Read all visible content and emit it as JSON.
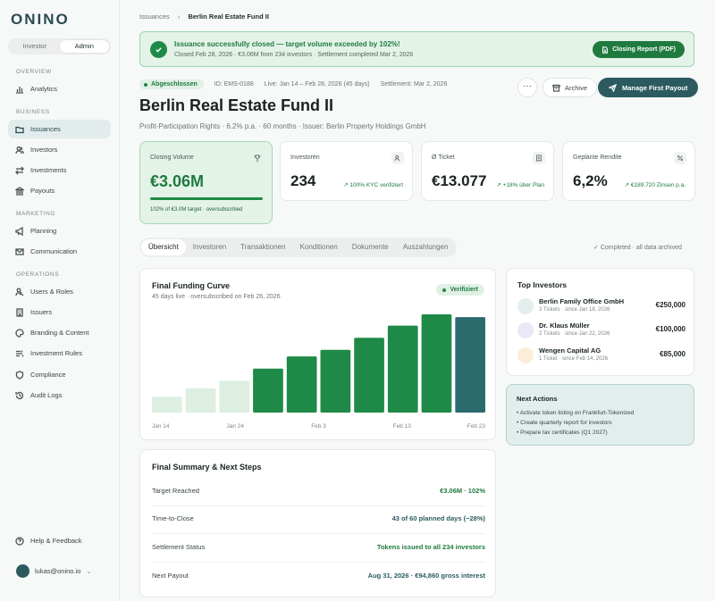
{
  "brand": {
    "logo": "ONINO"
  },
  "role_toggle": {
    "investor": "Investor",
    "admin": "Admin"
  },
  "sidebar": {
    "sections": [
      "OVERVIEW",
      "BUSINESS",
      "MARKETING",
      "OPERATIONS"
    ],
    "items": [
      {
        "label": "Analytics",
        "icon": "chart-icon"
      },
      {
        "label": "Issuances",
        "icon": "folder-icon"
      },
      {
        "label": "Investors",
        "icon": "users-icon"
      },
      {
        "label": "Investments",
        "icon": "swap-icon"
      },
      {
        "label": "Payouts",
        "icon": "bank-icon"
      },
      {
        "label": "Planning",
        "icon": "megaphone-icon"
      },
      {
        "label": "Communication",
        "icon": "mail-icon"
      },
      {
        "label": "Users & Roles",
        "icon": "user-key-icon"
      },
      {
        "label": "Issuers",
        "icon": "building-icon"
      },
      {
        "label": "Branding & Content",
        "icon": "palette-icon"
      },
      {
        "label": "Investment Rules",
        "icon": "rules-icon"
      },
      {
        "label": "Compliance",
        "icon": "shield-icon"
      },
      {
        "label": "Audit Logs",
        "icon": "history-icon"
      }
    ],
    "help": "Help & Feedback",
    "user_email": "lukas@onino.io"
  },
  "breadcrumb": {
    "parent": "Issuances",
    "current": "Berlin Real Estate Fund II"
  },
  "banner": {
    "title": "Issuance successfully closed — target volume exceeded by 102%!",
    "subtitle": "Closed Feb 28, 2026 · €3.06M from 234 investors · Settlement completed Mar 2, 2026",
    "button": "Closing Report (PDF)"
  },
  "meta": {
    "status": "Abgeschlossen",
    "id": "ID: EMS-0188",
    "live": "Live: Jan 14 – Feb 28, 2026 (45 days)",
    "settlement": "Settlement: Mar 2, 2026"
  },
  "actions": {
    "more": "···",
    "archive": "Archive",
    "payout": "Manage First Payout"
  },
  "fund": {
    "title": "Berlin Real Estate Fund II",
    "subtitle": "Profit-Participation Rights · 6.2% p.a. · 60 months · Issuer: Berlin Property Holdings GmbH"
  },
  "kpis": {
    "closing": {
      "label": "Closing Volume",
      "value": "€3.06M",
      "progress": 1.0,
      "foot": "102% of €3.0M target · oversubscribed"
    },
    "investors": {
      "label": "Investoren",
      "value": "234",
      "trend": "100% KYC verifiziert"
    },
    "ticket": {
      "label": "Ø Ticket",
      "value": "€13.077",
      "trend": "+18% über Plan"
    },
    "return": {
      "label": "Geplante Rendite",
      "value": "6,2%",
      "trend": "€189.720 Zinsen p.a."
    }
  },
  "tabs": [
    "Übersicht",
    "Investoren",
    "Transaktionen",
    "Konditionen",
    "Dokumente",
    "Auszahlungen"
  ],
  "archived_note": "Completed · all data archived",
  "chart_card": {
    "title": "Final Funding Curve",
    "subtitle": "45 days live · oversubscribed on Feb 26, 2026",
    "badge": "Verifiziert"
  },
  "chart_data": {
    "type": "bar",
    "x_tick_labels": [
      "Jan 14",
      "Jan 24",
      "Feb 3",
      "Feb 13",
      "Feb 23"
    ],
    "values": [
      0.17,
      0.26,
      0.34,
      0.47,
      0.6,
      0.67,
      0.8,
      0.93,
      1.05,
      1.02
    ],
    "value_unit": "fraction of largest bar (axis unlabeled)",
    "bar_colors": [
      "#dcefe0",
      "#dcefe0",
      "#dcefe0",
      "#1f8a47",
      "#1f8a47",
      "#1f8a47",
      "#1f8a47",
      "#1f8a47",
      "#1f8a47",
      "#2b6b6e"
    ],
    "title": "Final Funding Curve",
    "grid": false
  },
  "top_investors": {
    "title": "Top Investors",
    "rows": [
      {
        "name": "Berlin Family Office GmbH",
        "meta": "3 Tickets · since Jan 18, 2026",
        "amount": "€250,000",
        "color": "#e3efee"
      },
      {
        "name": "Dr. Klaus Müller",
        "meta": "2 Tickets · since Jan 22, 2026",
        "amount": "€100,000",
        "color": "#ebe7f7"
      },
      {
        "name": "Wengen Capital AG",
        "meta": "1 Ticket · since Feb 14, 2026",
        "amount": "€85,000",
        "color": "#fbeed8"
      }
    ]
  },
  "next_actions": {
    "title": "Next Actions",
    "items": [
      "• Activate token listing on Frankfurt-Tokenized",
      "• Create quarterly report for investors",
      "• Prepare tax certificates (Q1 2027)"
    ]
  },
  "summary": {
    "title": "Final Summary & Next Steps",
    "rows": [
      {
        "label": "Target Reached",
        "value": "€3.06M · 102%",
        "color": "#1f7a3f"
      },
      {
        "label": "Time-to-Close",
        "value": "43 of 60 planned days (−28%)",
        "color": "#2b5b60"
      },
      {
        "label": "Settlement Status",
        "value": "Tokens issued to all 234 investors",
        "color": "#1f7a3f"
      },
      {
        "label": "Next Payout",
        "value": "Aug 31, 2026 · €94,860 gross interest",
        "color": "#2b5b60"
      }
    ]
  },
  "colors": {
    "accent": "#2b5b60",
    "success": "#1f7a3f",
    "success_bg": "#e4f3e8"
  }
}
